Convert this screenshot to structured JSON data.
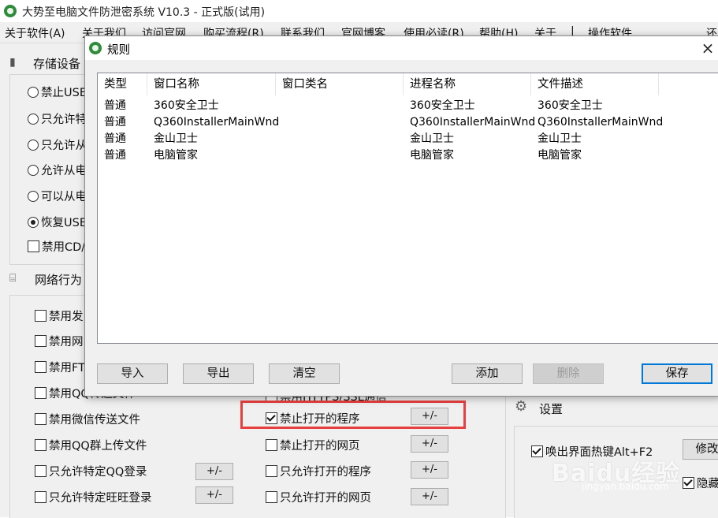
{
  "app": {
    "title": "大势至电脑文件防泄密系统 V10.3 - 正式版(试用)",
    "menu": [
      "关于软件(A)",
      "关于我们",
      "访问官网",
      "购买流程(R)",
      "联系我们",
      "官网博客",
      "使用必读(R)",
      "帮助(H)",
      "关于",
      "|",
      "操作软件",
      "",
      "还"
    ]
  },
  "left_panel": {
    "storage": {
      "title": "存储设备",
      "options": [
        {
          "label": "禁止USB",
          "type": "radio",
          "checked": false
        },
        {
          "label": "只允许特",
          "type": "radio",
          "checked": false
        },
        {
          "label": "只允许从",
          "type": "radio",
          "checked": false
        },
        {
          "label": "允许从电",
          "type": "radio",
          "checked": false
        },
        {
          "label": "可以从电",
          "type": "radio",
          "checked": false
        },
        {
          "label": "恢复USB",
          "type": "radio",
          "checked": true
        },
        {
          "label": "禁用CD/",
          "type": "checkbox",
          "checked": false
        }
      ]
    },
    "network": {
      "title": "网络行为",
      "col1": [
        {
          "label": "禁用发",
          "checked": false
        },
        {
          "label": "禁用网",
          "checked": false
        },
        {
          "label": "禁用FT",
          "checked": false
        },
        {
          "label": "禁用QQ传送文件",
          "checked": false
        },
        {
          "label": "禁用微信传送文件",
          "checked": false
        },
        {
          "label": "禁用QQ群上传文件",
          "checked": false
        },
        {
          "label": "只允许特定QQ登录",
          "checked": false,
          "pm": "+/-"
        },
        {
          "label": "只允许特定旺旺登录",
          "checked": false,
          "pm": "+/-"
        }
      ],
      "col2": [
        {
          "label": "禁用HTTPS/SSL通信",
          "checked": false
        },
        {
          "label": "禁止打开的程序",
          "checked": true,
          "pm": "+/-"
        },
        {
          "label": "禁止打开的网页",
          "checked": false,
          "pm": "+/-"
        },
        {
          "label": "只允许打开的程序",
          "checked": false,
          "pm": "+/-"
        },
        {
          "label": "只允许打开的网页",
          "checked": false,
          "pm": "+/-"
        }
      ]
    }
  },
  "settings": {
    "title": "设置",
    "hotkey_label": "唤出界面热键Alt+F2",
    "hotkey_checked": true,
    "modify_button": "修改",
    "hide_label": "隐藏",
    "hide_checked": true
  },
  "dialog": {
    "title": "规则",
    "close": "×",
    "columns": [
      "类型",
      "窗口名称",
      "窗口类名",
      "进程名称",
      "文件描述"
    ],
    "rows": [
      [
        "普通",
        "360安全卫士",
        "",
        "360安全卫士",
        "360安全卫士"
      ],
      [
        "普通",
        "Q360InstallerMainWnd",
        "",
        "Q360InstallerMainWnd",
        "Q360InstallerMainWnd"
      ],
      [
        "普通",
        "金山卫士",
        "",
        "金山卫士",
        "金山卫士"
      ],
      [
        "普通",
        "电脑管家",
        "",
        "电脑管家",
        "电脑管家"
      ]
    ],
    "buttons": {
      "import": "导入",
      "export": "导出",
      "clear": "清空",
      "add": "添加",
      "delete": "删除",
      "save": "保存"
    }
  },
  "watermark": {
    "brand": "Baidu经验",
    "url": "jingyan.baidu.com"
  },
  "colors": {
    "highlight": "#e8403f",
    "app_green": "#2e8b3a",
    "default_button_border": "#0078d7"
  }
}
